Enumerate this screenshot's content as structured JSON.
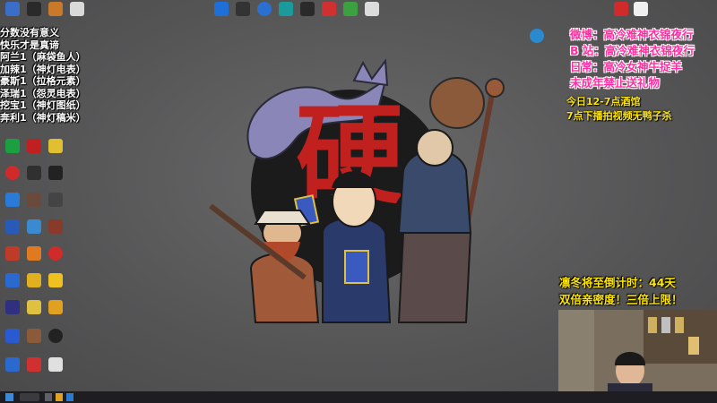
{
  "left_overlay": {
    "lines": [
      "分数没有意义",
      "快乐才是真谛",
      "阿兰1（麻袋鱼人）",
      "加辣1（神灯电表）",
      "豪斯1（拉格元素）",
      "泽瑞1（怨灵电表）",
      "挖宝1（神灯图纸）",
      "奔利1（神灯稿米）"
    ]
  },
  "right_overlay": {
    "pink_lines": [
      "微博：高冷难神衣锦夜行",
      "B 站：高冷难神衣锦夜行",
      "日常：高冷女神牛捉羊",
      "未成年禁止送礼物"
    ],
    "yellow_lines": [
      "今日12-7点酒馆",
      "7点下播拍视频无鸭子杀"
    ]
  },
  "countdown": {
    "lines": [
      "凛冬将至倒计时：44天",
      "双倍亲密度！三倍上限！"
    ]
  },
  "artwork": {
    "glyph": "硬"
  },
  "colors": {
    "accent_pink": "#ff2ea0",
    "accent_yellow": "#ffe600",
    "glyph_red": "#c0201e"
  }
}
